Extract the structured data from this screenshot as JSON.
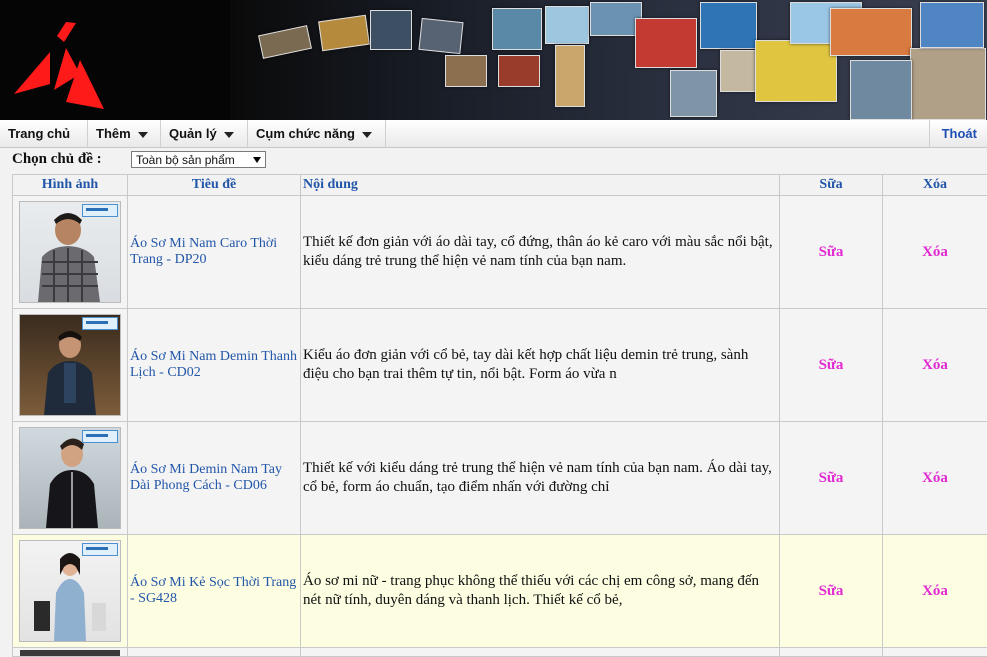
{
  "nav": {
    "items": [
      {
        "label": "Trang chủ",
        "dropdown": false
      },
      {
        "label": "Thêm",
        "dropdown": true
      },
      {
        "label": "Quản lý",
        "dropdown": true
      },
      {
        "label": "Cụm chức năng",
        "dropdown": true
      }
    ],
    "logout": "Thoát"
  },
  "filter": {
    "label": "Chọn chủ đề :",
    "selected": "Toàn bộ sản phẩm"
  },
  "table": {
    "headers": [
      "Hình ảnh",
      "Tiêu đề",
      "Nội dung",
      "Sữa",
      "Xóa"
    ],
    "rows": [
      {
        "title": "Áo Sơ Mi Nam Caro Thời Trang - DP20",
        "content": "Thiết kế đơn giản với áo dài tay, cổ đứng, thân áo kẻ caro với màu sắc nổi bật, kiểu dáng trẻ trung thể hiện vẻ nam tính của bạn nam.",
        "edit": "Sữa",
        "delete": "Xóa"
      },
      {
        "title": "Áo Sơ Mi Nam Demin Thanh Lịch - CD02",
        "content": "Kiểu áo đơn giản với cổ bẻ, tay dài kết hợp chất liệu demin trẻ trung, sành điệu cho bạn trai thêm tự tin, nổi bật. Form áo vừa n",
        "edit": "Sữa",
        "delete": "Xóa"
      },
      {
        "title": "Áo Sơ Mi Demin Nam Tay Dài Phong Cách - CD06",
        "content": "Thiết kế với kiểu dáng trẻ trung thể hiện vẻ nam tính của bạn nam. Áo dài tay, cổ bẻ, form áo chuẩn, tạo điểm nhấn với đường chỉ",
        "edit": "Sữa",
        "delete": "Xóa"
      },
      {
        "title": "Áo Sơ Mi Kẻ Sọc Thời Trang - SG428",
        "content": "Áo sơ mi nữ - trang phục không thể thiếu với các chị em công sở, mang đến nét nữ tính, duyên dáng và thanh lịch. Thiết kế cổ bẻ,",
        "edit": "Sữa",
        "delete": "Xóa"
      }
    ]
  },
  "colors": {
    "header_text": "#2256a8",
    "title_link": "#2256a8",
    "action_text": "#e12bd1",
    "logout_text": "#1f4eb4",
    "row_highlight": "#fdfde2"
  }
}
